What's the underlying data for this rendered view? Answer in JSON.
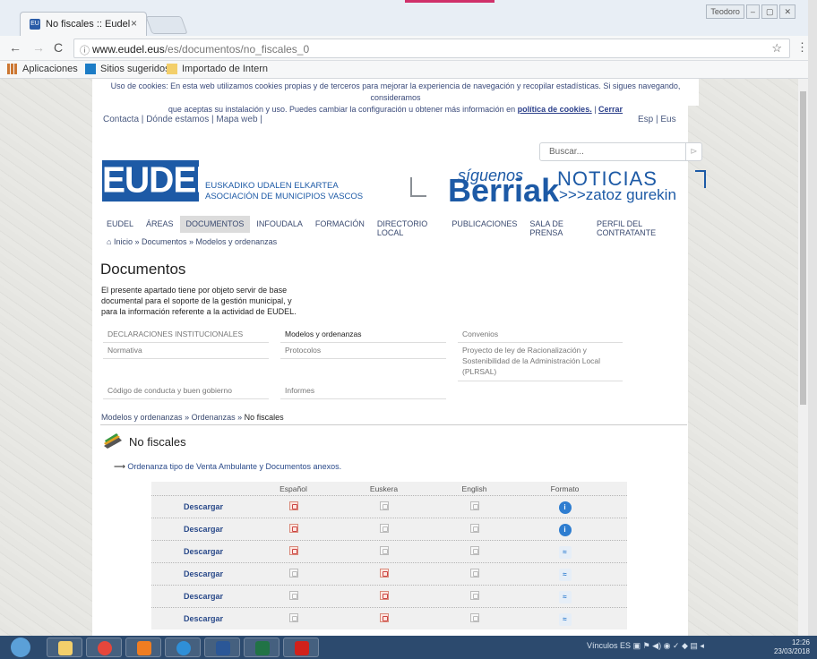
{
  "browser": {
    "tab_title": "No fiscales :: Eudel",
    "tab_close": "×",
    "url_host": "www.eudel.eus",
    "url_path": "/es/documentos/no_fiscales_0",
    "window_user": "Teodoro",
    "bookmarks": [
      "Aplicaciones",
      "Sitios sugeridos",
      "Importado de Intern"
    ]
  },
  "cookie": {
    "text_1": "Uso de cookies: En esta web utilizamos cookies propias y de terceros para mejorar la experiencia de navegación y recopilar estadísticas. Si sigues navegando, consideramos",
    "text_2": "que aceptas su instalación y uso. Puedes cambiar la configuración u obtener más información en",
    "link": "política de cookies.",
    "close": "Cerrar"
  },
  "toplinks": [
    "Contacta",
    "Dónde estamos",
    "Mapa web"
  ],
  "lang": [
    "Esp",
    "Eus"
  ],
  "search_placeholder": "Buscar...",
  "logo": {
    "text": "EUDEL",
    "line1": "EUSKADIKO UDALEN ELKARTEA",
    "line2": "ASOCIACIÓN DE MUNICIPIOS VASCOS"
  },
  "berriak": {
    "siguenos": "síguenos",
    "big": "Berriak",
    "noticias": "NOTICIAS",
    "zatoz": ">>>zatoz gurekin"
  },
  "nav": [
    "EUDEL",
    "ÁREAS",
    "DOCUMENTOS",
    "INFOUDALA",
    "FORMACIÓN",
    "DIRECTORIO LOCAL",
    "PUBLICACIONES",
    "SALA DE PRENSA",
    "PERFIL DEL CONTRATANTE"
  ],
  "breadcrumb": [
    "Inicio",
    "Documentos",
    "Modelos y ordenanzas"
  ],
  "page_title": "Documentos",
  "description": "El presente apartado tiene por objeto servir de base documental para el soporte de la gestión municipal, y para la información referente a la actividad de EUDEL.",
  "categories": [
    "DECLARACIONES INSTITUCIONALES",
    "Modelos y ordenanzas",
    "Convenios",
    "Normativa",
    "Protocolos",
    "Proyecto de ley de Racionalización y Sostenibilidad de la Administración Local (PLRSAL)",
    "Código de conducta y buen gobierno",
    "Informes"
  ],
  "subpath": [
    "Modelos y ordenanzas",
    "Ordenanzas",
    "No fiscales"
  ],
  "section_title": "No fiscales",
  "item_link": "Ordenanza tipo de Venta Ambulante y Documentos anexos.",
  "table": {
    "headers": [
      "Español",
      "Euskera",
      "English",
      "Formato"
    ],
    "download": "Descargar",
    "rows": [
      {
        "es": true,
        "eu": false,
        "en": false,
        "fmt": "info"
      },
      {
        "es": true,
        "eu": false,
        "en": false,
        "fmt": "info"
      },
      {
        "es": true,
        "eu": false,
        "en": false,
        "fmt": "doc"
      },
      {
        "es": false,
        "eu": true,
        "en": false,
        "fmt": "doc"
      },
      {
        "es": false,
        "eu": true,
        "en": false,
        "fmt": "doc"
      },
      {
        "es": false,
        "eu": true,
        "en": false,
        "fmt": "doc"
      }
    ]
  },
  "taskbar": {
    "tray_label": "Vínculos",
    "tray_lang": "ES",
    "time": "12:26",
    "date": "23/03/2018"
  }
}
